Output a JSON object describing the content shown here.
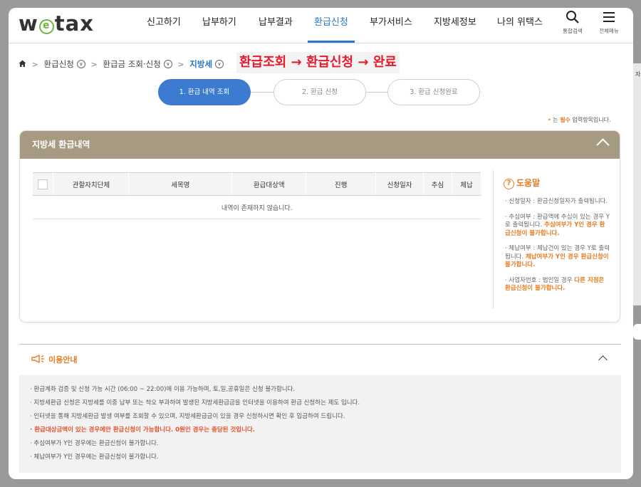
{
  "header": {
    "logo_text": "wetax",
    "menu": [
      {
        "label": "신고하기",
        "active": false
      },
      {
        "label": "납부하기",
        "active": false
      },
      {
        "label": "납부결과",
        "active": false
      },
      {
        "label": "환급신청",
        "active": true
      },
      {
        "label": "부가서비스",
        "active": false
      },
      {
        "label": "지방세정보",
        "active": false
      },
      {
        "label": "나의 위택스",
        "active": false
      }
    ],
    "search_label": "통합검색",
    "allmenu_label": "전체메뉴",
    "accent_color": "#2b77c9"
  },
  "breadcrumb": {
    "items": [
      "환급신청",
      "환급금 조회·신청",
      "지방세"
    ]
  },
  "annotation": "환급조회 → 환급신청 → 완료",
  "steps": [
    "1. 환급 내역 조회",
    "2. 환급 신청",
    "3. 환급 신청완료"
  ],
  "required_note": {
    "prefix": "는",
    "bold": "필수",
    "suffix": "입력항목입니다."
  },
  "panel": {
    "title": "지방세 환급내역",
    "header_color": "#a79a83",
    "columns": [
      "관할자치단체",
      "세목명",
      "환급대상액",
      "진행",
      "신청일자",
      "추심",
      "체납"
    ],
    "empty_text": "내역이 존재하지 않습니다."
  },
  "help": {
    "title": "도움말",
    "items": [
      {
        "text": "신청일자 : 환급신청일자가 출력됩니다.",
        "emph": ""
      },
      {
        "text": "추심여부 : 환급액에 추심이 있는 경우 Y로 출력됩니다. ",
        "emph": "추심여부가 Y인 경우 환급신청이 불가합니다."
      },
      {
        "text": "체납여부 : 체납건이 있는 경우 Y로 출력됩니다. ",
        "emph": "체납여부가 Y인 경우 환급신청이 불가합니다."
      },
      {
        "text": "사업자번호 : 법인일 경우 ",
        "emph": "다른 지점은 환급신청이 불가합니다."
      }
    ]
  },
  "info": {
    "title": "이용안내",
    "items": [
      {
        "text": "환급계좌 검증 및 신청 가능 시간 (06:00 ~ 22:00)에 이용 가능하며, 토,일,공휴일은 신청 불가합니다.",
        "emph": false
      },
      {
        "text": "지방세환급 신청은 지방세를 이중 납부 또는 착오 부과하여 발생된 지방세환급금을 인터넷을 이용하여 환급 신청하는 제도 입니다.",
        "emph": false
      },
      {
        "text": "인터넷을 통해 지방세환급 발생 여부를 조회할 수 있으며, 지방세환급금이 있을 경우 신청하시면 확인 후 입금하여 드립니다.",
        "emph": false
      },
      {
        "text": "환급대상금액이 있는 경우에만 환급신청이 가능합니다. 0원인 경우는 충당된 것입니다.",
        "emph": true
      },
      {
        "text": "추심여부가 Y인 경우에는 환급신청이 불가합니다.",
        "emph": false
      },
      {
        "text": "체납여부가 Y인 경우에는 환급신청이 불가합니다.",
        "emph": false
      }
    ]
  }
}
